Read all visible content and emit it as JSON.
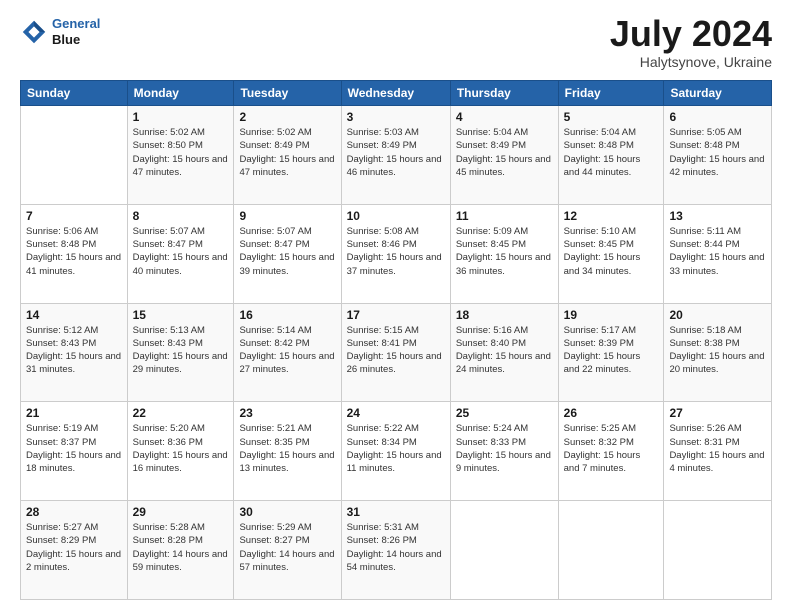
{
  "logo": {
    "line1": "General",
    "line2": "Blue"
  },
  "title": "July 2024",
  "location": "Halytsynove, Ukraine",
  "header_days": [
    "Sunday",
    "Monday",
    "Tuesday",
    "Wednesday",
    "Thursday",
    "Friday",
    "Saturday"
  ],
  "weeks": [
    [
      {
        "date": "",
        "sunrise": "",
        "sunset": "",
        "daylight": ""
      },
      {
        "date": "1",
        "sunrise": "Sunrise: 5:02 AM",
        "sunset": "Sunset: 8:50 PM",
        "daylight": "Daylight: 15 hours and 47 minutes."
      },
      {
        "date": "2",
        "sunrise": "Sunrise: 5:02 AM",
        "sunset": "Sunset: 8:49 PM",
        "daylight": "Daylight: 15 hours and 47 minutes."
      },
      {
        "date": "3",
        "sunrise": "Sunrise: 5:03 AM",
        "sunset": "Sunset: 8:49 PM",
        "daylight": "Daylight: 15 hours and 46 minutes."
      },
      {
        "date": "4",
        "sunrise": "Sunrise: 5:04 AM",
        "sunset": "Sunset: 8:49 PM",
        "daylight": "Daylight: 15 hours and 45 minutes."
      },
      {
        "date": "5",
        "sunrise": "Sunrise: 5:04 AM",
        "sunset": "Sunset: 8:48 PM",
        "daylight": "Daylight: 15 hours and 44 minutes."
      },
      {
        "date": "6",
        "sunrise": "Sunrise: 5:05 AM",
        "sunset": "Sunset: 8:48 PM",
        "daylight": "Daylight: 15 hours and 42 minutes."
      }
    ],
    [
      {
        "date": "7",
        "sunrise": "Sunrise: 5:06 AM",
        "sunset": "Sunset: 8:48 PM",
        "daylight": "Daylight: 15 hours and 41 minutes."
      },
      {
        "date": "8",
        "sunrise": "Sunrise: 5:07 AM",
        "sunset": "Sunset: 8:47 PM",
        "daylight": "Daylight: 15 hours and 40 minutes."
      },
      {
        "date": "9",
        "sunrise": "Sunrise: 5:07 AM",
        "sunset": "Sunset: 8:47 PM",
        "daylight": "Daylight: 15 hours and 39 minutes."
      },
      {
        "date": "10",
        "sunrise": "Sunrise: 5:08 AM",
        "sunset": "Sunset: 8:46 PM",
        "daylight": "Daylight: 15 hours and 37 minutes."
      },
      {
        "date": "11",
        "sunrise": "Sunrise: 5:09 AM",
        "sunset": "Sunset: 8:45 PM",
        "daylight": "Daylight: 15 hours and 36 minutes."
      },
      {
        "date": "12",
        "sunrise": "Sunrise: 5:10 AM",
        "sunset": "Sunset: 8:45 PM",
        "daylight": "Daylight: 15 hours and 34 minutes."
      },
      {
        "date": "13",
        "sunrise": "Sunrise: 5:11 AM",
        "sunset": "Sunset: 8:44 PM",
        "daylight": "Daylight: 15 hours and 33 minutes."
      }
    ],
    [
      {
        "date": "14",
        "sunrise": "Sunrise: 5:12 AM",
        "sunset": "Sunset: 8:43 PM",
        "daylight": "Daylight: 15 hours and 31 minutes."
      },
      {
        "date": "15",
        "sunrise": "Sunrise: 5:13 AM",
        "sunset": "Sunset: 8:43 PM",
        "daylight": "Daylight: 15 hours and 29 minutes."
      },
      {
        "date": "16",
        "sunrise": "Sunrise: 5:14 AM",
        "sunset": "Sunset: 8:42 PM",
        "daylight": "Daylight: 15 hours and 27 minutes."
      },
      {
        "date": "17",
        "sunrise": "Sunrise: 5:15 AM",
        "sunset": "Sunset: 8:41 PM",
        "daylight": "Daylight: 15 hours and 26 minutes."
      },
      {
        "date": "18",
        "sunrise": "Sunrise: 5:16 AM",
        "sunset": "Sunset: 8:40 PM",
        "daylight": "Daylight: 15 hours and 24 minutes."
      },
      {
        "date": "19",
        "sunrise": "Sunrise: 5:17 AM",
        "sunset": "Sunset: 8:39 PM",
        "daylight": "Daylight: 15 hours and 22 minutes."
      },
      {
        "date": "20",
        "sunrise": "Sunrise: 5:18 AM",
        "sunset": "Sunset: 8:38 PM",
        "daylight": "Daylight: 15 hours and 20 minutes."
      }
    ],
    [
      {
        "date": "21",
        "sunrise": "Sunrise: 5:19 AM",
        "sunset": "Sunset: 8:37 PM",
        "daylight": "Daylight: 15 hours and 18 minutes."
      },
      {
        "date": "22",
        "sunrise": "Sunrise: 5:20 AM",
        "sunset": "Sunset: 8:36 PM",
        "daylight": "Daylight: 15 hours and 16 minutes."
      },
      {
        "date": "23",
        "sunrise": "Sunrise: 5:21 AM",
        "sunset": "Sunset: 8:35 PM",
        "daylight": "Daylight: 15 hours and 13 minutes."
      },
      {
        "date": "24",
        "sunrise": "Sunrise: 5:22 AM",
        "sunset": "Sunset: 8:34 PM",
        "daylight": "Daylight: 15 hours and 11 minutes."
      },
      {
        "date": "25",
        "sunrise": "Sunrise: 5:24 AM",
        "sunset": "Sunset: 8:33 PM",
        "daylight": "Daylight: 15 hours and 9 minutes."
      },
      {
        "date": "26",
        "sunrise": "Sunrise: 5:25 AM",
        "sunset": "Sunset: 8:32 PM",
        "daylight": "Daylight: 15 hours and 7 minutes."
      },
      {
        "date": "27",
        "sunrise": "Sunrise: 5:26 AM",
        "sunset": "Sunset: 8:31 PM",
        "daylight": "Daylight: 15 hours and 4 minutes."
      }
    ],
    [
      {
        "date": "28",
        "sunrise": "Sunrise: 5:27 AM",
        "sunset": "Sunset: 8:29 PM",
        "daylight": "Daylight: 15 hours and 2 minutes."
      },
      {
        "date": "29",
        "sunrise": "Sunrise: 5:28 AM",
        "sunset": "Sunset: 8:28 PM",
        "daylight": "Daylight: 14 hours and 59 minutes."
      },
      {
        "date": "30",
        "sunrise": "Sunrise: 5:29 AM",
        "sunset": "Sunset: 8:27 PM",
        "daylight": "Daylight: 14 hours and 57 minutes."
      },
      {
        "date": "31",
        "sunrise": "Sunrise: 5:31 AM",
        "sunset": "Sunset: 8:26 PM",
        "daylight": "Daylight: 14 hours and 54 minutes."
      },
      {
        "date": "",
        "sunrise": "",
        "sunset": "",
        "daylight": ""
      },
      {
        "date": "",
        "sunrise": "",
        "sunset": "",
        "daylight": ""
      },
      {
        "date": "",
        "sunrise": "",
        "sunset": "",
        "daylight": ""
      }
    ]
  ]
}
